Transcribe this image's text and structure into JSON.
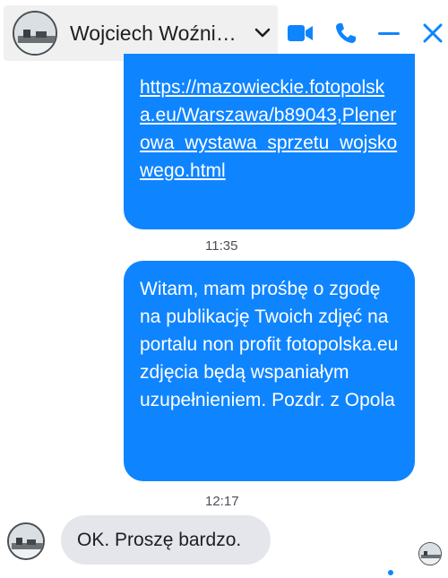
{
  "header": {
    "contact_name": "Wojciech Woźni…",
    "icons": [
      "avatar",
      "chevron-down-icon",
      "video-call-icon",
      "phone-icon",
      "minimize-icon",
      "close-icon"
    ],
    "accent_color": "#0f84ff"
  },
  "messages": {
    "link_text": "https://mazowieckie.fotopolska.eu/Warszawa/b89043,Plenerowa_wystawa_sprzetu_wojskowego.html",
    "time_1": "11:35",
    "request_text": "Witam, mam prośbę o zgodę na publikację Twoich zdjęć na portalu non profit fotopolska.eu zdjęcia będą wspaniałym uzupełnieniem. Pozdr. z Opola",
    "time_2": "12:17",
    "reply_text": "OK. Proszę bardzo."
  },
  "colors": {
    "sent_bubble": "#0f84ff",
    "received_bubble": "#e4e6eb"
  }
}
